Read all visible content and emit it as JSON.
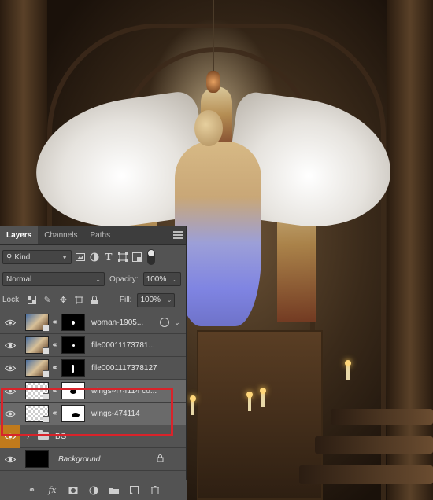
{
  "panel": {
    "tabs": [
      {
        "label": "Layers",
        "active": true
      },
      {
        "label": "Channels",
        "active": false
      },
      {
        "label": "Paths",
        "active": false
      }
    ],
    "filter": {
      "kind_label": "Kind"
    },
    "blend_mode": "Normal",
    "opacity_label": "Opacity:",
    "opacity_value": "100%",
    "lock_label": "Lock:",
    "fill_label": "Fill:",
    "fill_value": "100%"
  },
  "layers": [
    {
      "name": "woman-1905...",
      "thumb": "photo",
      "mask": "black",
      "selected": false
    },
    {
      "name": "file00011173781...",
      "thumb": "photo",
      "mask": "black",
      "selected": false
    },
    {
      "name": "file0001117378127",
      "thumb": "photo",
      "mask": "black",
      "selected": false
    },
    {
      "name": "wings-474114 co...",
      "thumb": "transparent",
      "mask": "white",
      "selected": true
    },
    {
      "name": "wings-474114",
      "thumb": "transparent",
      "mask": "white",
      "selected": true
    },
    {
      "name": "BG",
      "type": "group"
    },
    {
      "name": "Background",
      "type": "background",
      "locked": true
    }
  ],
  "colors": {
    "panel_bg": "#535353",
    "selected_row": "#6a6a6a",
    "highlight_border": "#d9232a",
    "group_eye": "#c07a1c"
  }
}
